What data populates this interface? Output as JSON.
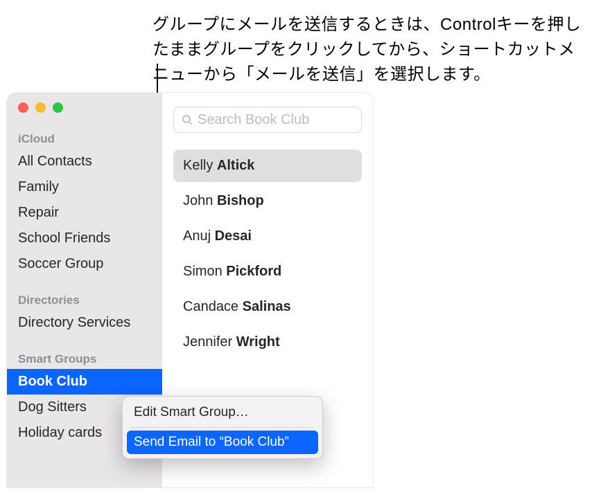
{
  "caption": "グループにメールを送信するときは、Controlキーを押したままグループをクリックしてから、ショートカットメニューから「メールを送信」を選択します。",
  "sidebar": {
    "sections": [
      {
        "header": "iCloud",
        "items": [
          "All Contacts",
          "Family",
          "Repair",
          "School Friends",
          "Soccer Group"
        ]
      },
      {
        "header": "Directories",
        "items": [
          "Directory Services"
        ]
      },
      {
        "header": "Smart Groups",
        "items": [
          "Book Club",
          "Dog Sitters",
          "Holiday cards"
        ]
      }
    ],
    "selected": "Book Club"
  },
  "search": {
    "placeholder": "Search Book Club"
  },
  "contacts": [
    {
      "first": "Kelly",
      "last": "Altick",
      "selected": true
    },
    {
      "first": "John",
      "last": "Bishop",
      "selected": false
    },
    {
      "first": "Anuj",
      "last": "Desai",
      "selected": false
    },
    {
      "first": "Simon",
      "last": "Pickford",
      "selected": false
    },
    {
      "first": "Candace",
      "last": "Salinas",
      "selected": false
    },
    {
      "first": "Jennifer",
      "last": "Wright",
      "selected": false
    }
  ],
  "context_menu": {
    "edit": "Edit Smart Group…",
    "send": "Send Email to “Book Club”"
  }
}
